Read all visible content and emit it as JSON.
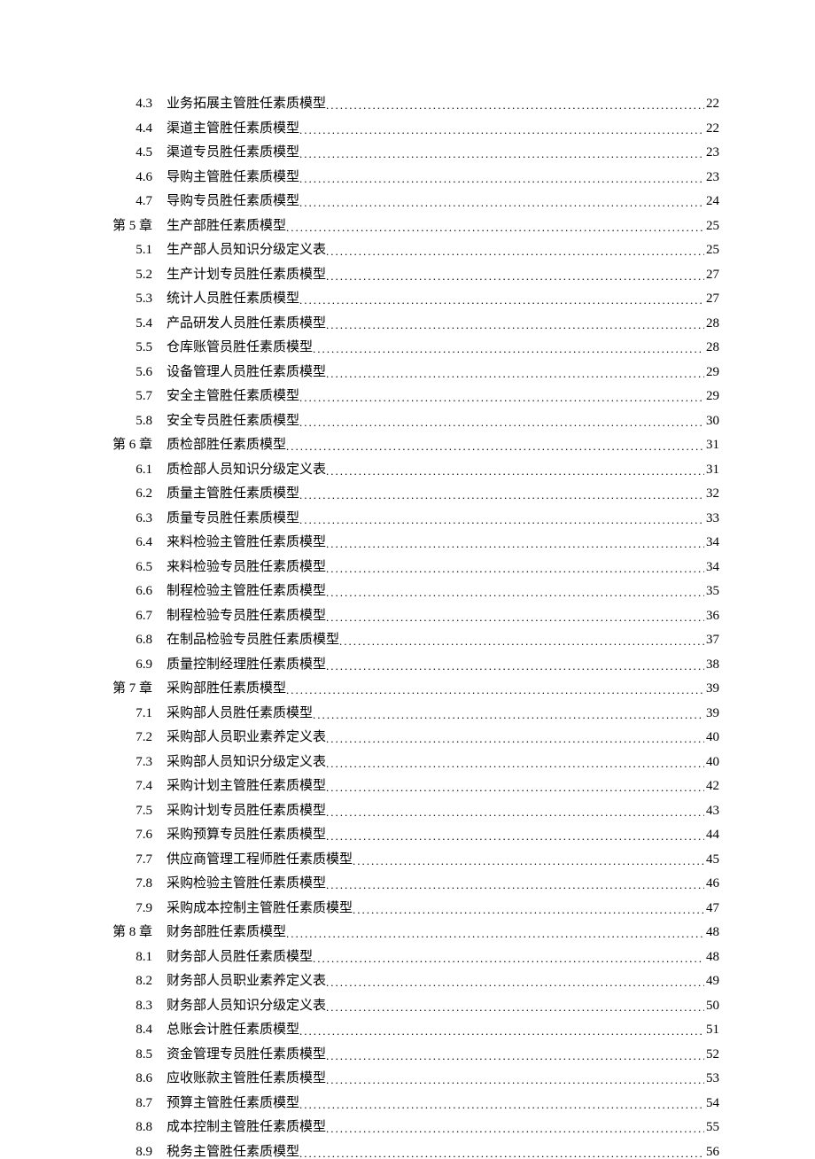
{
  "toc": [
    {
      "level": "sub",
      "num": "4.3",
      "title": "业务拓展主管胜任素质模型",
      "page": "22"
    },
    {
      "level": "sub",
      "num": "4.4",
      "title": "渠道主管胜任素质模型",
      "page": "22"
    },
    {
      "level": "sub",
      "num": "4.5",
      "title": "渠道专员胜任素质模型",
      "page": "23"
    },
    {
      "level": "sub",
      "num": "4.6",
      "title": "导购主管胜任素质模型",
      "page": "23"
    },
    {
      "level": "sub",
      "num": "4.7",
      "title": "导购专员胜任素质模型",
      "page": "24"
    },
    {
      "level": "chapter",
      "num": "第 5 章",
      "title": "生产部胜任素质模型",
      "page": "25"
    },
    {
      "level": "sub",
      "num": "5.1",
      "title": "生产部人员知识分级定义表",
      "page": "25"
    },
    {
      "level": "sub",
      "num": "5.2",
      "title": "生产计划专员胜任素质模型",
      "page": "27"
    },
    {
      "level": "sub",
      "num": "5.3",
      "title": "统计人员胜任素质模型",
      "page": "27"
    },
    {
      "level": "sub",
      "num": "5.4",
      "title": "产品研发人员胜任素质模型",
      "page": "28"
    },
    {
      "level": "sub",
      "num": "5.5",
      "title": "仓库账管员胜任素质模型",
      "page": "28"
    },
    {
      "level": "sub",
      "num": "5.6",
      "title": "设备管理人员胜任素质模型",
      "page": "29"
    },
    {
      "level": "sub",
      "num": "5.7",
      "title": "安全主管胜任素质模型",
      "page": "29"
    },
    {
      "level": "sub",
      "num": "5.8",
      "title": "安全专员胜任素质模型",
      "page": "30"
    },
    {
      "level": "chapter",
      "num": "第 6 章",
      "title": "质检部胜任素质模型",
      "page": "31"
    },
    {
      "level": "sub",
      "num": "6.1",
      "title": "质检部人员知识分级定义表",
      "page": "31"
    },
    {
      "level": "sub",
      "num": "6.2",
      "title": "质量主管胜任素质模型",
      "page": "32"
    },
    {
      "level": "sub",
      "num": "6.3",
      "title": "质量专员胜任素质模型",
      "page": "33"
    },
    {
      "level": "sub",
      "num": "6.4",
      "title": "来料检验主管胜任素质模型",
      "page": "34"
    },
    {
      "level": "sub",
      "num": "6.5",
      "title": "来料检验专员胜任素质模型",
      "page": "34"
    },
    {
      "level": "sub",
      "num": "6.6",
      "title": "制程检验主管胜任素质模型",
      "page": "35"
    },
    {
      "level": "sub",
      "num": "6.7",
      "title": "制程检验专员胜任素质模型",
      "page": "36"
    },
    {
      "level": "sub",
      "num": "6.8",
      "title": "在制品检验专员胜任素质模型",
      "page": "37"
    },
    {
      "level": "sub",
      "num": "6.9",
      "title": "质量控制经理胜任素质模型",
      "page": "38"
    },
    {
      "level": "chapter",
      "num": "第 7 章",
      "title": "采购部胜任素质模型",
      "page": "39"
    },
    {
      "level": "sub",
      "num": "7.1",
      "title": "采购部人员胜任素质模型",
      "page": "39"
    },
    {
      "level": "sub",
      "num": "7.2",
      "title": "采购部人员职业素养定义表",
      "page": "40"
    },
    {
      "level": "sub",
      "num": "7.3",
      "title": "采购部人员知识分级定义表",
      "page": "40"
    },
    {
      "level": "sub",
      "num": "7.4",
      "title": "采购计划主管胜任素质模型",
      "page": "42"
    },
    {
      "level": "sub",
      "num": "7.5",
      "title": "采购计划专员胜任素质模型",
      "page": "43"
    },
    {
      "level": "sub",
      "num": "7.6",
      "title": "采购预算专员胜任素质模型",
      "page": "44"
    },
    {
      "level": "sub",
      "num": "7.7",
      "title": "供应商管理工程师胜任素质模型",
      "page": "45"
    },
    {
      "level": "sub",
      "num": "7.8",
      "title": "采购检验主管胜任素质模型",
      "page": "46"
    },
    {
      "level": "sub",
      "num": "7.9",
      "title": "采购成本控制主管胜任素质模型",
      "page": "47"
    },
    {
      "level": "chapter",
      "num": "第 8 章",
      "title": "财务部胜任素质模型",
      "page": "48"
    },
    {
      "level": "sub",
      "num": "8.1",
      "title": "财务部人员胜任素质模型",
      "page": "48"
    },
    {
      "level": "sub",
      "num": "8.2",
      "title": "财务部人员职业素养定义表",
      "page": "49"
    },
    {
      "level": "sub",
      "num": "8.3",
      "title": "财务部人员知识分级定义表",
      "page": "50"
    },
    {
      "level": "sub",
      "num": "8.4",
      "title": "总账会计胜任素质模型",
      "page": "51"
    },
    {
      "level": "sub",
      "num": "8.5",
      "title": "资金管理专员胜任素质模型",
      "page": "52"
    },
    {
      "level": "sub",
      "num": "8.6",
      "title": "应收账款主管胜任素质模型",
      "page": "53"
    },
    {
      "level": "sub",
      "num": "8.7",
      "title": "预算主管胜任素质模型",
      "page": "54"
    },
    {
      "level": "sub",
      "num": "8.8",
      "title": "成本控制主管胜任素质模型",
      "page": "55"
    },
    {
      "level": "sub",
      "num": "8.9",
      "title": "税务主管胜任素质模型",
      "page": "56"
    }
  ]
}
